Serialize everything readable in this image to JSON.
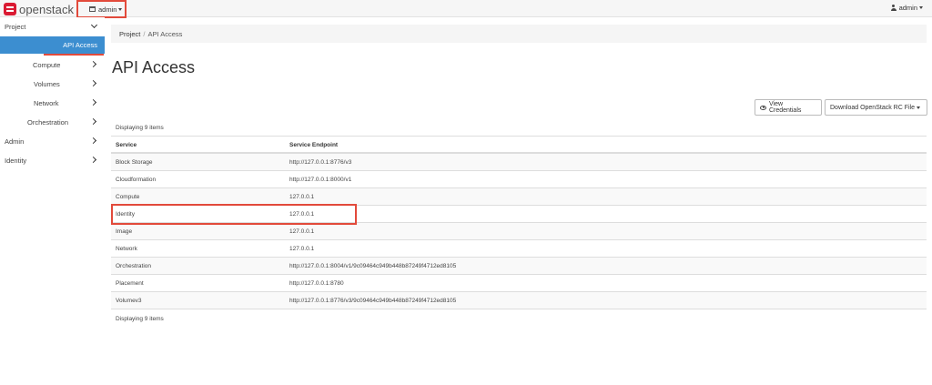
{
  "brand": {
    "name": "openstack"
  },
  "navbar": {
    "project_dropdown": "admin",
    "user_dropdown": "admin"
  },
  "sidebar": {
    "project": "Project",
    "api_access": "API Access",
    "compute": "Compute",
    "volumes": "Volumes",
    "network": "Network",
    "orchestration": "Orchestration",
    "admin": "Admin",
    "identity": "Identity"
  },
  "breadcrumb": {
    "root": "Project",
    "separator": "/",
    "current": "API Access"
  },
  "page_title": "API Access",
  "actions": {
    "view_credentials": "View Credentials",
    "download_rc": "Download OpenStack RC File"
  },
  "table": {
    "count_label": "Displaying 9 items",
    "headers": [
      "Service",
      "Service Endpoint"
    ],
    "rows": [
      [
        "Block Storage",
        "http://127.0.0.1:8776/v3"
      ],
      [
        "Cloudformation",
        "http://127.0.0.1:8000/v1"
      ],
      [
        "Compute",
        "127.0.0.1"
      ],
      [
        "Identity",
        "127.0.0.1"
      ],
      [
        "Image",
        "127.0.0.1"
      ],
      [
        "Network",
        "127.0.0.1"
      ],
      [
        "Orchestration",
        "http://127.0.0.1:8004/v1/9c09464c949b448b87249f4712ed8105"
      ],
      [
        "Placement",
        "http://127.0.0.1:8780"
      ],
      [
        "Volumev3",
        "http://127.0.0.1:8776/v3/9c09464c949b448b87249f4712ed8105"
      ]
    ]
  },
  "colors": {
    "accent": "#3c8ed0",
    "highlight": "#e24a3b",
    "brand": "#da1a32"
  }
}
